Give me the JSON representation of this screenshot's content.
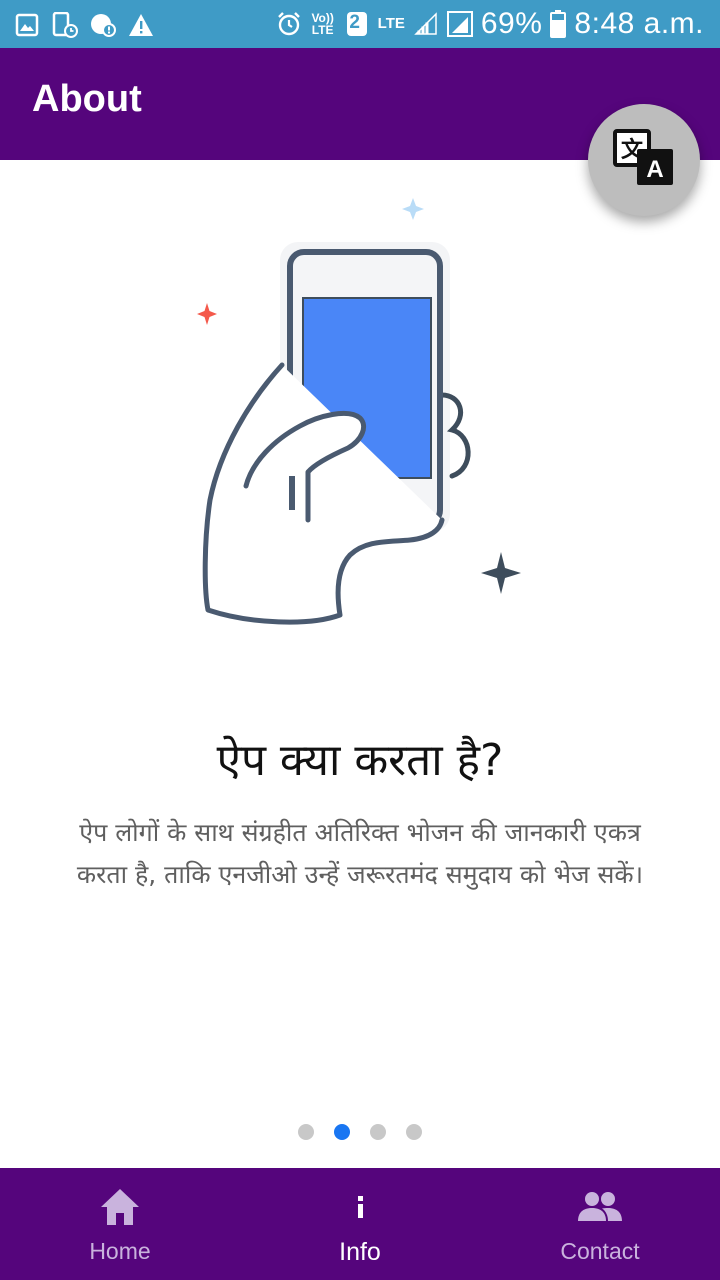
{
  "status_bar": {
    "left_icons": [
      "gallery-icon",
      "schedule-icon",
      "data-alert-icon",
      "warning-icon"
    ],
    "volte_label": "Vo)) LTE",
    "sim_label": "2",
    "lte_label": "LTE",
    "battery_percent": "69%",
    "time": "8:48 a.m."
  },
  "app_bar": {
    "title": "About",
    "translate_icon": "translate-icon"
  },
  "slide": {
    "heading": "ऐप क्या करता है?",
    "description": "ऐप लोगों के साथ संग्रहीत अतिरिक्त भोजन की जानकारी एकत्र करता है, ताकि एनजीओ उन्हें जरूरतमंद समुदाय को भेज सकें।",
    "illustration": "hand-holding-phone-illustration"
  },
  "pager": {
    "total": 4,
    "active_index": 1
  },
  "bottom_nav": {
    "items": [
      {
        "label": "Home",
        "icon": "home-icon",
        "active": false
      },
      {
        "label": "Info",
        "icon": "info-icon",
        "active": true
      },
      {
        "label": "Contact",
        "icon": "people-icon",
        "active": false
      }
    ]
  },
  "colors": {
    "status_bar": "#3f9bc6",
    "primary": "#55057c",
    "accent_dot": "#1976f2",
    "phone_screen": "#4a86f7",
    "sparkle_red": "#f4594b",
    "sparkle_blue": "#b9dcf7"
  }
}
